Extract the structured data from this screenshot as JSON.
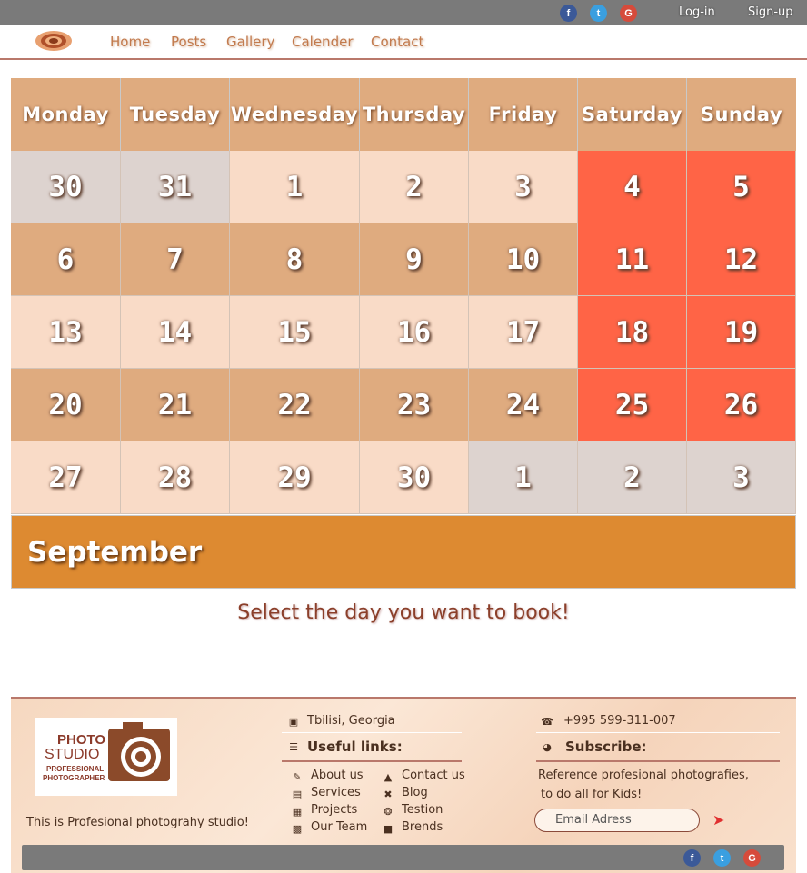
{
  "topbar": {
    "social": [
      {
        "icon": "facebook-icon",
        "glyph": "f"
      },
      {
        "icon": "twitter-icon",
        "glyph": "t"
      },
      {
        "icon": "google-icon",
        "glyph": "G"
      }
    ],
    "login": "Log-in",
    "signup": "Sign-up"
  },
  "nav": {
    "items": [
      "Home",
      "Posts",
      "Gallery",
      "Calender",
      "Contact"
    ]
  },
  "calendar": {
    "weekdays": [
      "Monday",
      "Tuesday",
      "Wednesday",
      "Thursday",
      "Friday",
      "Saturday",
      "Sunday"
    ],
    "weeks": [
      [
        "30",
        "31",
        "1",
        "2",
        "3",
        "4",
        "5"
      ],
      [
        "6",
        "7",
        "8",
        "9",
        "10",
        "11",
        "12"
      ],
      [
        "13",
        "14",
        "15",
        "16",
        "17",
        "18",
        "19"
      ],
      [
        "20",
        "21",
        "22",
        "23",
        "24",
        "25",
        "26"
      ],
      [
        "27",
        "28",
        "29",
        "30",
        "1",
        "2",
        "3"
      ]
    ],
    "month": "September",
    "prompt": "Select the day you want to book!",
    "colors": {
      "header": "#dfab7f",
      "other_month": "#ddd3cf",
      "light_row": "#f9dbc7",
      "tan_row": "#dfab7f",
      "weekend": "#ff6446",
      "month_bar": "#dd8a31"
    }
  },
  "footer": {
    "logo": {
      "line1": "PHOTO",
      "line2": "STUDIO",
      "line3": "PROFESSIONAL",
      "line4": "PHOTOGRAPHER"
    },
    "tagline": "This is Profesional photograhy studio!",
    "address": "Tbilisi, Georgia",
    "phone": "+995 599-311-007",
    "useful_links_title": "Useful links:",
    "subscribe_title": "Subscribe:",
    "links_left": [
      "About us",
      "Services",
      "Projects",
      "Our Team"
    ],
    "links_right": [
      "Contact us",
      "Blog",
      "Testion",
      "Brends"
    ],
    "subscribe_text_1": "Reference profesional photografies,",
    "subscribe_text_2": "to do all for Kids!",
    "email_placeholder": "Email Adress"
  }
}
